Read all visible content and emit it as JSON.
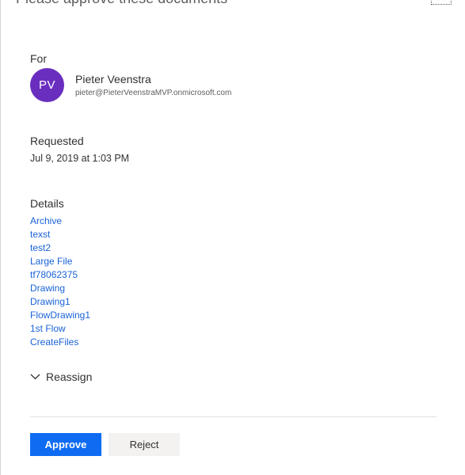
{
  "panel": {
    "title": "Please approve these documents"
  },
  "for_section": {
    "label": "For",
    "avatar_initials": "PV",
    "avatar_color": "#6a2ebf",
    "name": "Pieter Veenstra",
    "email": "pieter@PieterVeenstraMVP.onmicrosoft.com"
  },
  "requested_section": {
    "label": "Requested",
    "date": "Jul 9, 2019 at 1:03 PM"
  },
  "details_section": {
    "label": "Details",
    "items": [
      {
        "label": "Archive"
      },
      {
        "label": "texst"
      },
      {
        "label": "test2"
      },
      {
        "label": "Large File"
      },
      {
        "label": "tf78062375"
      },
      {
        "label": "Drawing"
      },
      {
        "label": "Drawing1"
      },
      {
        "label": "FlowDrawing1"
      },
      {
        "label": "1st Flow"
      },
      {
        "label": "CreateFiles"
      }
    ],
    "link_color": "#1a63d8"
  },
  "reassign": {
    "label": "Reassign",
    "icon": "chevron-down-icon"
  },
  "actions": {
    "approve_label": "Approve",
    "reject_label": "Reject",
    "approve_color": "#0f6cf2"
  }
}
